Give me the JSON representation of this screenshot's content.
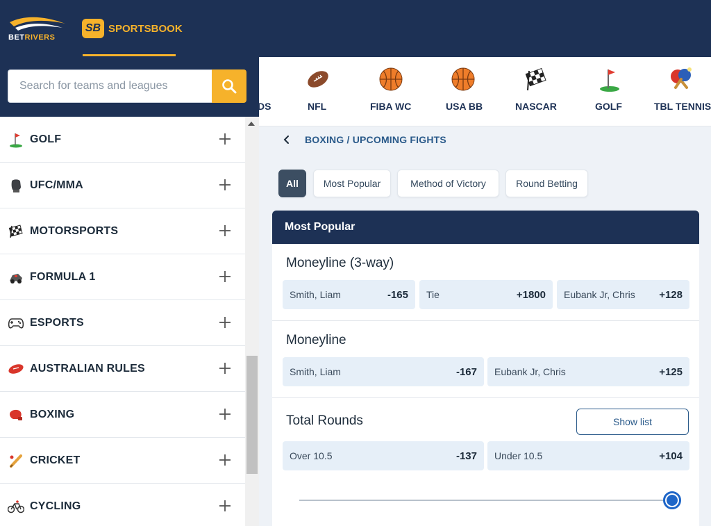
{
  "header": {
    "brand_main": "BET",
    "brand_accent": "RIVERS",
    "sb_badge": "SB",
    "sb_label": "SPORTSBOOK"
  },
  "search": {
    "placeholder": "Search for teams and leagues",
    "value": ""
  },
  "sidebar": {
    "items": [
      {
        "label": "GOLF",
        "icon": "golf-flag-icon"
      },
      {
        "label": "UFC/MMA",
        "icon": "glove-icon"
      },
      {
        "label": "MOTORSPORTS",
        "icon": "checkered-flag-icon"
      },
      {
        "label": "FORMULA 1",
        "icon": "race-car-icon"
      },
      {
        "label": "ESPORTS",
        "icon": "gamepad-icon"
      },
      {
        "label": "AUSTRALIAN RULES",
        "icon": "aussie-ball-icon"
      },
      {
        "label": "BOXING",
        "icon": "boxing-glove-icon"
      },
      {
        "label": "CRICKET",
        "icon": "cricket-bat-icon"
      },
      {
        "label": "CYCLING",
        "icon": "bicycle-icon"
      }
    ]
  },
  "sports_strip": {
    "partial_label": "DS",
    "items": [
      {
        "label": "NFL",
        "icon": "football-icon"
      },
      {
        "label": "FIBA WC",
        "icon": "basketball-icon"
      },
      {
        "label": "USA BB",
        "icon": "basketball-icon"
      },
      {
        "label": "NASCAR",
        "icon": "checkered-flag-icon"
      },
      {
        "label": "GOLF",
        "icon": "golf-flag-icon"
      },
      {
        "label": "TBL TENNIS",
        "icon": "table-tennis-icon"
      }
    ]
  },
  "breadcrumb": {
    "text": "BOXING / UPCOMING FIGHTS"
  },
  "filters": [
    {
      "label": "All",
      "active": true
    },
    {
      "label": "Most Popular",
      "active": false
    },
    {
      "label": "Method of Victory",
      "active": false
    },
    {
      "label": "Round Betting",
      "active": false
    }
  ],
  "card": {
    "title": "Most Popular",
    "markets": [
      {
        "title": "Moneyline (3-way)",
        "outcomes": [
          {
            "name": "Smith, Liam",
            "price": "-165"
          },
          {
            "name": "Tie",
            "price": "+1800"
          },
          {
            "name": "Eubank Jr, Chris",
            "price": "+128"
          }
        ]
      },
      {
        "title": "Moneyline",
        "outcomes": [
          {
            "name": "Smith, Liam",
            "price": "-167"
          },
          {
            "name": "Eubank Jr, Chris",
            "price": "+125"
          }
        ]
      },
      {
        "title": "Total Rounds",
        "show_list": "Show list",
        "outcomes": [
          {
            "name": "Over 10.5",
            "price": "-137"
          },
          {
            "name": "Under 10.5",
            "price": "+104"
          }
        ]
      }
    ]
  },
  "colors": {
    "navy": "#1d3155",
    "gold": "#f6b22b",
    "odd_bg": "#e6eff8",
    "link_blue": "#2a5a8a",
    "slider_blue": "#1e66c8"
  }
}
